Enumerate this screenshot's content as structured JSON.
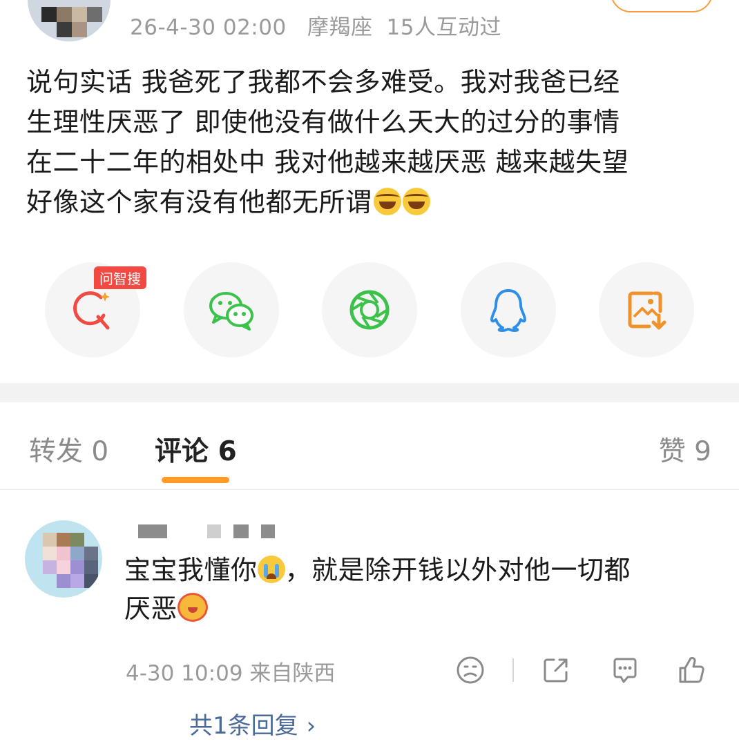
{
  "post": {
    "date": "26-4-30 02:00",
    "zodiac": "摩羯座",
    "interactions": "15人互动过",
    "text_lines": [
      "说句实话 我爸死了我都不会多难受。我对我爸已经",
      "生理性厌恶了 即使他没有做什么天大的过分的事情",
      "在二十二年的相处中 我对他越来越厌恶 越来越失望",
      "好像这个家有没有他都无所谓"
    ],
    "text_emojis": [
      "laugh-cry-emoji",
      "laugh-cry-emoji"
    ]
  },
  "share": {
    "badge": "问智搜",
    "items": [
      {
        "name": "search-share-icon",
        "color": "#f04a43"
      },
      {
        "name": "wechat-icon",
        "color": "#3cc24b"
      },
      {
        "name": "moments-icon",
        "color": "#3cc24b"
      },
      {
        "name": "qq-icon",
        "color": "#2f8fe8"
      },
      {
        "name": "save-image-icon",
        "color": "#f0922c"
      }
    ]
  },
  "tabs": {
    "repost": "转发 0",
    "comments": "评论 6",
    "likes": "赞 9",
    "accent": "#ff9b26"
  },
  "comment": {
    "text_lines": [
      "宝宝我懂你",
      "，就是除开钱以外对他一切都",
      "厌恶"
    ],
    "time_location": "4-30 10:09  来自陕西",
    "replies": "共1条回复",
    "reply_chevron": "›",
    "reply_color": "#4a6a9a"
  }
}
